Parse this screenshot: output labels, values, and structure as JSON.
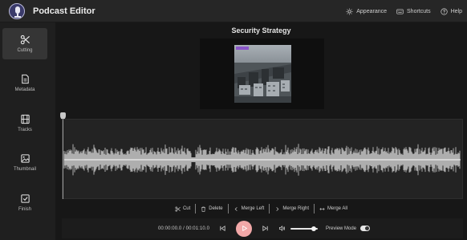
{
  "app": {
    "title": "Podcast Editor",
    "accent": "#f2a8a8"
  },
  "topbar": {
    "actions": [
      {
        "label": "Appearance",
        "icon": "sun-icon"
      },
      {
        "label": "Shortcuts",
        "icon": "keyboard-icon"
      },
      {
        "label": "Help",
        "icon": "help-circle-icon"
      }
    ]
  },
  "sidebar": {
    "items": [
      {
        "label": "Cutting",
        "icon": "scissors-icon",
        "active": true
      },
      {
        "label": "Metadata",
        "icon": "document-icon",
        "active": false
      },
      {
        "label": "Tracks",
        "icon": "film-icon",
        "active": false
      },
      {
        "label": "Thumbnail",
        "icon": "image-icon",
        "active": false
      },
      {
        "label": "Finish",
        "icon": "check-square-icon",
        "active": false
      }
    ]
  },
  "main": {
    "title": "Security Strategy"
  },
  "edit_toolbar": {
    "buttons": [
      {
        "label": "Cut",
        "icon": "scissors-icon"
      },
      {
        "label": "Delete",
        "icon": "trash-icon"
      },
      {
        "label": "Merge Left",
        "icon": "chevron-left-icon"
      },
      {
        "label": "Merge Right",
        "icon": "chevron-right-icon"
      },
      {
        "label": "Merge All",
        "icon": "arrows-horizontal-icon"
      }
    ]
  },
  "player": {
    "timecode": "00:00:00.0 / 00:01:10.0",
    "volume_level": 0.85,
    "preview_mode_label": "Preview Mode",
    "preview_mode_on": true
  }
}
